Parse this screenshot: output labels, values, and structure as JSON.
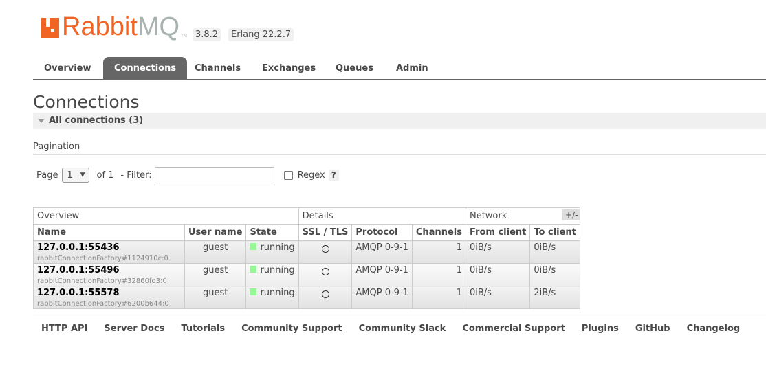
{
  "header": {
    "logo_text": "RabbitMQ",
    "version": "3.8.2",
    "erlang": "Erlang 22.2.7"
  },
  "tabs": [
    "Overview",
    "Connections",
    "Channels",
    "Exchanges",
    "Queues",
    "Admin"
  ],
  "page_title": "Connections",
  "section_title": "All connections (3)",
  "pagination": {
    "label": "Pagination",
    "page_label": "Page",
    "page_value": "1",
    "of_label": "of 1",
    "filter_label": "- Filter:",
    "filter_value": "",
    "regex_label": "Regex",
    "help": "?"
  },
  "table": {
    "groups": [
      "Overview",
      "Details",
      "Network"
    ],
    "columns": [
      "Name",
      "User name",
      "State",
      "SSL / TLS",
      "Protocol",
      "Channels",
      "From client",
      "To client"
    ],
    "toggle": "+/-",
    "rows": [
      {
        "name": "127.0.0.1:55436",
        "client": "rabbitConnectionFactory#1124910c:0",
        "user": "guest",
        "state": "running",
        "protocol": "AMQP 0-9-1",
        "channels": "1",
        "from": "0iB/s",
        "to": "0iB/s"
      },
      {
        "name": "127.0.0.1:55496",
        "client": "rabbitConnectionFactory#32860fd3:0",
        "user": "guest",
        "state": "running",
        "protocol": "AMQP 0-9-1",
        "channels": "1",
        "from": "0iB/s",
        "to": "0iB/s"
      },
      {
        "name": "127.0.0.1:55578",
        "client": "rabbitConnectionFactory#6200b644:0",
        "user": "guest",
        "state": "running",
        "protocol": "AMQP 0-9-1",
        "channels": "1",
        "from": "0iB/s",
        "to": "2iB/s"
      }
    ]
  },
  "footer": [
    "HTTP API",
    "Server Docs",
    "Tutorials",
    "Community Support",
    "Community Slack",
    "Commercial Support",
    "Plugins",
    "GitHub",
    "Changelog"
  ],
  "colors": {
    "brand": "#f06524",
    "running": "#98f898"
  }
}
